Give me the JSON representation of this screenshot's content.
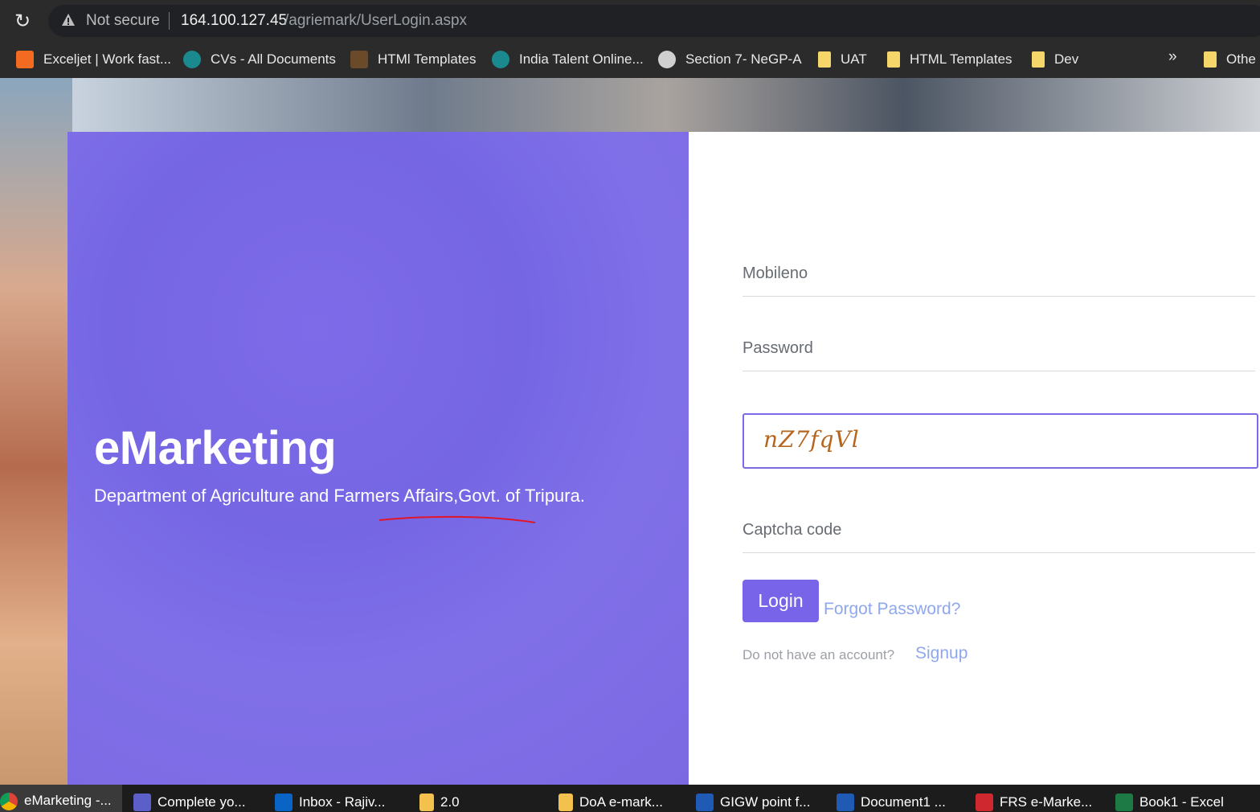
{
  "browser": {
    "security_label": "Not secure",
    "url_host": "164.100.127.45",
    "url_path": "/agriemark/UserLogin.aspx"
  },
  "bookmarks": [
    {
      "label": "Exceljet | Work fast...",
      "icon": "exceljet-icon"
    },
    {
      "label": "CVs - All Documents",
      "icon": "sharepoint-icon"
    },
    {
      "label": "HTMl Templates",
      "icon": "book-icon"
    },
    {
      "label": "India Talent Online...",
      "icon": "sharepoint-icon"
    },
    {
      "label": "Section 7- NeGP-A",
      "icon": "globe-icon"
    },
    {
      "label": "UAT",
      "icon": "folder-icon"
    },
    {
      "label": "HTML Templates",
      "icon": "folder-icon"
    },
    {
      "label": "Dev",
      "icon": "folder-icon"
    }
  ],
  "bookmarks_overflow": "»",
  "bookmarks_other": "Othe",
  "hero": {
    "title": "eMarketing",
    "subtitle": "Department of Agriculture and Farmers Affairs,Govt. of Tripura."
  },
  "form": {
    "mobile_placeholder": "Mobileno",
    "password_placeholder": "Password",
    "captcha_image_text": "nZ7fqVl",
    "captcha_placeholder": "Captcha code",
    "login_label": "Login",
    "forgot_label": "Forgot Password?",
    "no_account_text": "Do not have an account?",
    "signup_label": "Signup"
  },
  "taskbar": [
    {
      "label": "eMarketing -...",
      "icon": "chrome-icon",
      "active": true
    },
    {
      "label": "Complete yo...",
      "icon": "teams-icon"
    },
    {
      "label": "Inbox - Rajiv...",
      "icon": "outlook-icon"
    },
    {
      "label": "2.0",
      "icon": "folder-icon"
    },
    {
      "label": "DoA e-mark...",
      "icon": "folder-icon"
    },
    {
      "label": "GIGW point f...",
      "icon": "word-icon"
    },
    {
      "label": "Document1 ...",
      "icon": "word-icon"
    },
    {
      "label": "FRS e-Marke...",
      "icon": "pdf-icon"
    },
    {
      "label": "Book1 - Excel",
      "icon": "excel-icon"
    }
  ],
  "colors": {
    "accent": "#7764e8",
    "panel": "#7566e4",
    "link": "#8fa7ee",
    "captcha_text": "#b5651d"
  }
}
